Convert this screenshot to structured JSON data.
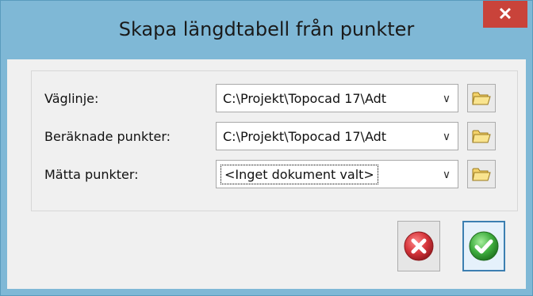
{
  "window": {
    "title": "Skapa längdtabell från punkter",
    "close_glyph": "✕"
  },
  "fields": [
    {
      "label": "Väglinje:",
      "value": "C:\\Projekt\\Topocad 17\\Adt",
      "arrow": "∨",
      "icon": "folder-icon"
    },
    {
      "label": "Beräknade punkter:",
      "value": "C:\\Projekt\\Topocad 17\\Adt",
      "arrow": "∨",
      "icon": "folder-icon"
    },
    {
      "label": "Mätta punkter:",
      "value": "<Inget dokument valt>",
      "arrow": "∨",
      "icon": "folder-icon"
    }
  ],
  "buttons": {
    "cancel_icon": "cancel-icon",
    "ok_icon": "ok-check-icon"
  },
  "colors": {
    "frame": "#7fb8d6",
    "close": "#c9433a",
    "cancel": "#d6363c",
    "ok": "#3fae3f"
  }
}
